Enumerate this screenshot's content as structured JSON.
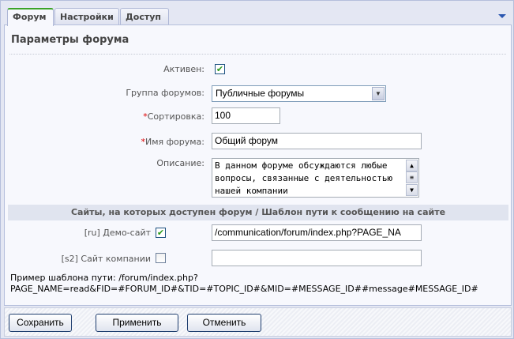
{
  "tabs": [
    {
      "label": "Форум",
      "active": true
    },
    {
      "label": "Настройки",
      "active": false
    },
    {
      "label": "Доступ",
      "active": false
    }
  ],
  "menu_icon": "triangle-down-icon",
  "title": "Параметры форума",
  "fields": {
    "active": {
      "label": "Активен:",
      "checked": true
    },
    "group": {
      "label": "Группа форумов:",
      "value": "Публичные форумы"
    },
    "sort": {
      "required": "*",
      "label": "Сортировка:",
      "value": "100"
    },
    "name": {
      "required": "*",
      "label": "Имя форума:",
      "value": "Общий форум"
    },
    "description": {
      "label": "Описание:",
      "value": "В данном форуме обсуждаются любые вопросы, связанные с деятельностью нашей компании"
    }
  },
  "sites_section": {
    "header": "Сайты, на которых доступен форум / Шаблон пути к сообщению на сайте",
    "sites": [
      {
        "label": "[ru] Демо-сайт",
        "checked": true,
        "path": "/communication/forum/index.php?PAGE_NA"
      },
      {
        "label": "[s2] Сайт компании",
        "checked": false,
        "path": ""
      }
    ],
    "example_line1": "Пример шаблона пути: /forum/index.php?",
    "example_line2": "PAGE_NAME=read&FID=#FORUM_ID#&TID=#TOPIC_ID#&MID=#MESSAGE_ID##message#MESSAGE_ID#"
  },
  "buttons": {
    "save": "Сохранить",
    "apply": "Применить",
    "cancel": "Отменить"
  },
  "colors": {
    "active_tab_accent": "#3aa327",
    "check": "#2a9a19",
    "required": "#dd0000"
  }
}
